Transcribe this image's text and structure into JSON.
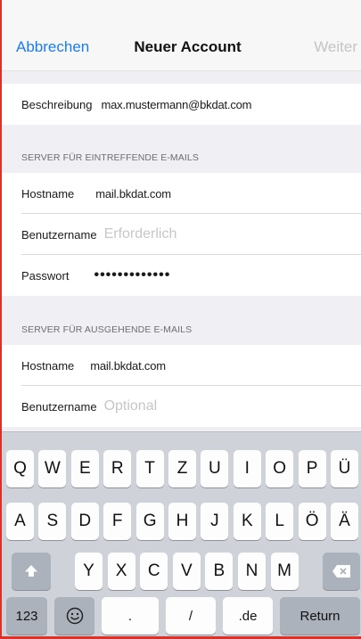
{
  "nav": {
    "cancel_label": "Abbrechen",
    "title": "Neuer Account",
    "next_label": "Weiter"
  },
  "account": {
    "description_label": "Beschreibung",
    "description_value": "max.mustermann@bkdat.com"
  },
  "incoming": {
    "section_title": "SERVER FÜR EINTREFFENDE E-MAILS",
    "hostname_label": "Hostname",
    "hostname_value": "mail.bkdat.com",
    "username_label": "Benutzername",
    "username_placeholder": "Erforderlich",
    "password_label": "Passwort",
    "password_value": "•••••••••••••"
  },
  "outgoing": {
    "section_title": "SERVER FÜR AUSGEHENDE E-MAILS",
    "hostname_label": "Hostname",
    "hostname_value": "mail.bkdat.com",
    "username_label": "Benutzername",
    "username_placeholder": "Optional"
  },
  "keyboard": {
    "row1": [
      "Q",
      "W",
      "E",
      "R",
      "T",
      "Z",
      "U",
      "I",
      "O",
      "P",
      "Ü"
    ],
    "row2": [
      "A",
      "S",
      "D",
      "F",
      "G",
      "H",
      "J",
      "K",
      "L",
      "Ö",
      "Ä"
    ],
    "row3": [
      "Y",
      "X",
      "C",
      "V",
      "B",
      "N",
      "M"
    ],
    "numbers_label": "123",
    "dot_label": ".",
    "slash_label": "/",
    "de_label": ".de",
    "return_label": "Return",
    "shift_icon": "shift-arrow-icon",
    "delete_icon": "backspace-icon",
    "emoji_icon": "emoji-icon"
  },
  "colors": {
    "accent": "#1b7cf0",
    "frame_border": "#d8322a"
  }
}
